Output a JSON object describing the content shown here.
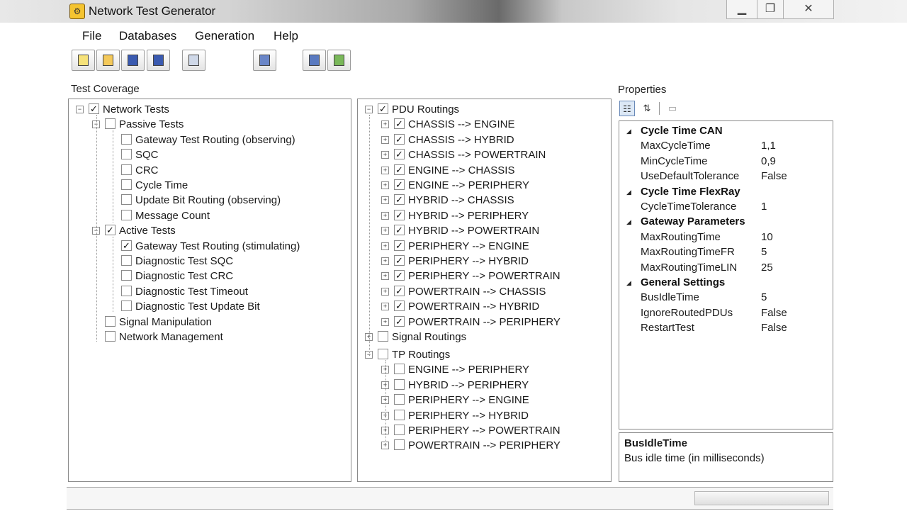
{
  "window": {
    "title": "Network Test Generator"
  },
  "window_buttons": {
    "minimize": "▁",
    "maximize": "❐",
    "close": "✕"
  },
  "menu": [
    "File",
    "Databases",
    "Generation",
    "Help"
  ],
  "toolbar": {
    "buttons": [
      "new-file-icon",
      "open-folder-icon",
      "save-icon",
      "save-all-icon",
      "network-icon",
      "generate-icon",
      "import-icon",
      "report-icon"
    ]
  },
  "test_coverage": {
    "label": "Test Coverage",
    "tree": [
      {
        "text": "Network Tests",
        "checked": true,
        "expander": "-"
      },
      {
        "text": "Passive Tests",
        "checked": false,
        "expander": "-"
      },
      {
        "text": "Gateway Test Routing (observing)",
        "checked": false
      },
      {
        "text": "SQC",
        "checked": false
      },
      {
        "text": "CRC",
        "checked": false
      },
      {
        "text": "Cycle Time",
        "checked": false
      },
      {
        "text": "Update Bit Routing (observing)",
        "checked": false
      },
      {
        "text": "Message Count",
        "checked": false
      },
      {
        "text": "Active Tests",
        "checked": true,
        "expander": "-"
      },
      {
        "text": "Gateway Test Routing (stimulating)",
        "checked": true
      },
      {
        "text": "Diagnostic Test SQC",
        "checked": false
      },
      {
        "text": "Diagnostic Test CRC",
        "checked": false
      },
      {
        "text": "Diagnostic Test Timeout",
        "checked": false
      },
      {
        "text": "Diagnostic Test Update Bit",
        "checked": false
      },
      {
        "text": "Signal Manipulation",
        "checked": false
      },
      {
        "text": "Network Management",
        "checked": false
      }
    ]
  },
  "routings": {
    "tree": [
      {
        "text": "PDU Routings",
        "checked": true,
        "expander": "-"
      },
      {
        "text": "CHASSIS --> ENGINE",
        "checked": true,
        "expander": "+"
      },
      {
        "text": "CHASSIS --> HYBRID",
        "checked": true,
        "expander": "+"
      },
      {
        "text": "CHASSIS --> POWERTRAIN",
        "checked": true,
        "expander": "+"
      },
      {
        "text": "ENGINE --> CHASSIS",
        "checked": true,
        "expander": "+"
      },
      {
        "text": "ENGINE --> PERIPHERY",
        "checked": true,
        "expander": "+"
      },
      {
        "text": "HYBRID --> CHASSIS",
        "checked": true,
        "expander": "+"
      },
      {
        "text": "HYBRID --> PERIPHERY",
        "checked": true,
        "expander": "+"
      },
      {
        "text": "HYBRID --> POWERTRAIN",
        "checked": true,
        "expander": "+"
      },
      {
        "text": "PERIPHERY --> ENGINE",
        "checked": true,
        "expander": "+"
      },
      {
        "text": "PERIPHERY --> HYBRID",
        "checked": true,
        "expander": "+"
      },
      {
        "text": "PERIPHERY --> POWERTRAIN",
        "checked": true,
        "expander": "+"
      },
      {
        "text": "POWERTRAIN --> CHASSIS",
        "checked": true,
        "expander": "+"
      },
      {
        "text": "POWERTRAIN --> HYBRID",
        "checked": true,
        "expander": "+"
      },
      {
        "text": "POWERTRAIN --> PERIPHERY",
        "checked": true,
        "expander": "+"
      },
      {
        "text": "Signal Routings",
        "checked": false,
        "expander": "+"
      },
      {
        "text": "TP Routings",
        "checked": false,
        "expander": "-"
      },
      {
        "text": "ENGINE --> PERIPHERY",
        "checked": false,
        "expander": "+"
      },
      {
        "text": "HYBRID --> PERIPHERY",
        "checked": false,
        "expander": "+"
      },
      {
        "text": "PERIPHERY --> ENGINE",
        "checked": false,
        "expander": "+"
      },
      {
        "text": "PERIPHERY --> HYBRID",
        "checked": false,
        "expander": "+"
      },
      {
        "text": "PERIPHERY --> POWERTRAIN",
        "checked": false,
        "expander": "+"
      },
      {
        "text": "POWERTRAIN --> PERIPHERY",
        "checked": false,
        "expander": "+"
      }
    ]
  },
  "properties": {
    "label": "Properties",
    "toolbar": [
      "categorized-icon",
      "alphabetical-icon",
      "property-pages-icon"
    ],
    "categories": [
      {
        "name": "Cycle Time CAN",
        "items": [
          {
            "name": "MaxCycleTime",
            "value": "1,1"
          },
          {
            "name": "MinCycleTime",
            "value": "0,9"
          },
          {
            "name": "UseDefaultTolerance",
            "value": "False"
          }
        ]
      },
      {
        "name": "Cycle Time FlexRay",
        "items": [
          {
            "name": "CycleTimeTolerance",
            "value": "1"
          }
        ]
      },
      {
        "name": "Gateway Parameters",
        "items": [
          {
            "name": "MaxRoutingTime",
            "value": "10"
          },
          {
            "name": "MaxRoutingTimeFR",
            "value": "5"
          },
          {
            "name": "MaxRoutingTimeLIN",
            "value": "25"
          }
        ]
      },
      {
        "name": "General Settings",
        "items": [
          {
            "name": "BusIdleTime",
            "value": "5"
          },
          {
            "name": "IgnoreRoutedPDUs",
            "value": "False"
          },
          {
            "name": "RestartTest",
            "value": "False"
          }
        ]
      }
    ],
    "description": {
      "title": "BusIdleTime",
      "text": "Bus idle time (in milliseconds)"
    }
  }
}
